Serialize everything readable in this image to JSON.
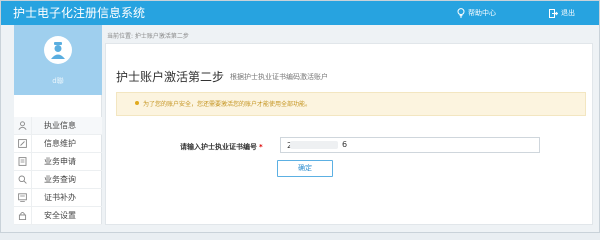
{
  "header": {
    "title": "护士电子化注册信息系统",
    "help_label": "帮助中心",
    "logout_label": "退出"
  },
  "sidebar": {
    "username": "d聯",
    "items": [
      {
        "label": "执业信息",
        "icon": "user-icon"
      },
      {
        "label": "信息维护",
        "icon": "edit-icon"
      },
      {
        "label": "业务申请",
        "icon": "document-icon"
      },
      {
        "label": "业务查询",
        "icon": "search-icon"
      },
      {
        "label": "证书补办",
        "icon": "certificate-icon"
      },
      {
        "label": "安全设置",
        "icon": "lock-icon"
      }
    ]
  },
  "breadcrumb": "当前位置: 护士账户激活第二步",
  "main": {
    "title": "护士账户激活第二步",
    "subtitle": "根据护士执业证书编码激活账户",
    "notice": "为了您的账户安全，您还需要激活您的账户才能使用全部功能。",
    "field_label": "请输入护士执业证书编号",
    "required_mark": "*",
    "field_value_prefix": "2",
    "field_value_suffix": "6",
    "confirm_label": "确定"
  },
  "colors": {
    "header_bg": "#27a3e0",
    "profile_bg": "#9fcfee",
    "notice_bg": "#fcf4df",
    "notice_text": "#c49420",
    "button_border": "#5cb0e3"
  }
}
